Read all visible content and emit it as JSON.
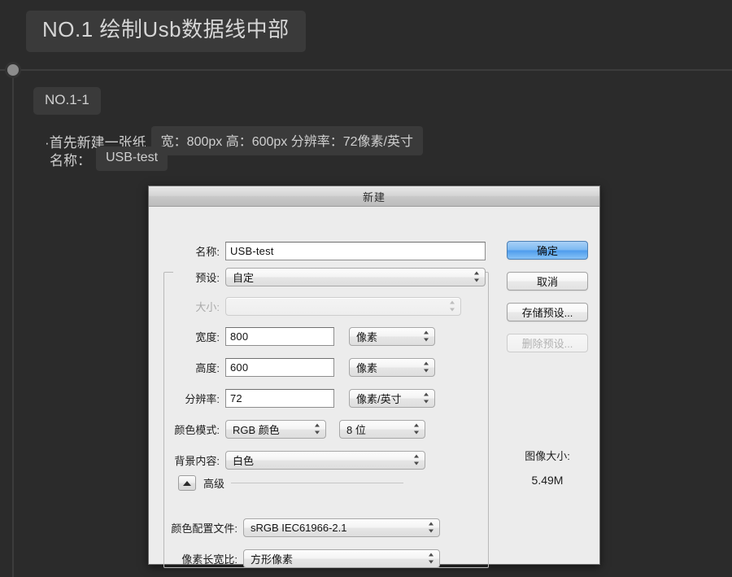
{
  "note": {
    "header_badge": "NO.1 绘制Usb数据线中部",
    "sub_badge": "NO.1-1",
    "step_text": "·首先新建一张纸",
    "spec_chip": "宽：800px 高：600px 分辨率：72像素/英寸",
    "name_label": "名称：",
    "name_chip": "USB-test"
  },
  "dialog": {
    "title": "新建",
    "fields": {
      "name_label": "名称:",
      "name_value": "USB-test",
      "preset_label": "预设:",
      "preset_value": "自定",
      "size_label": "大小:",
      "size_value": "",
      "width_label": "宽度:",
      "width_value": "800",
      "width_unit": "像素",
      "height_label": "高度:",
      "height_value": "600",
      "height_unit": "像素",
      "resolution_label": "分辨率:",
      "resolution_value": "72",
      "resolution_unit": "像素/英寸",
      "color_mode_label": "颜色模式:",
      "color_mode_value": "RGB 颜色",
      "bit_depth_value": "8 位",
      "background_label": "背景内容:",
      "background_value": "白色",
      "advanced_label": "高级",
      "color_profile_label": "颜色配置文件:",
      "color_profile_value": "sRGB IEC61966-2.1",
      "pixel_aspect_label": "像素长宽比:",
      "pixel_aspect_value": "方形像素"
    },
    "buttons": {
      "ok": "确定",
      "cancel": "取消",
      "save_preset": "存储预设...",
      "delete_preset": "删除预设..."
    },
    "image_size": {
      "caption": "图像大小:",
      "value": "5.49M"
    }
  },
  "colors": {
    "page_background": "#2b2b2b",
    "badge_background": "#3a3a3a",
    "dialog_background": "#ececec",
    "primary_button": "#4e9ced"
  }
}
